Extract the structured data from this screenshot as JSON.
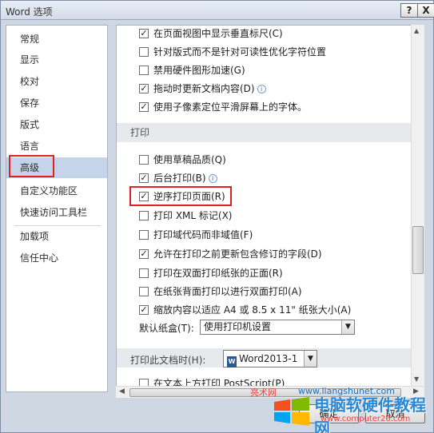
{
  "window": {
    "title": "Word 选项",
    "help": "?",
    "close": "X"
  },
  "sidebar": {
    "items": [
      {
        "label": "常规"
      },
      {
        "label": "显示"
      },
      {
        "label": "校对"
      },
      {
        "label": "保存"
      },
      {
        "label": "版式"
      },
      {
        "label": "语言"
      },
      {
        "label": "高级",
        "selected": true
      },
      {
        "label": "自定义功能区"
      },
      {
        "label": "快速访问工具栏"
      },
      {
        "label": "加载项"
      },
      {
        "label": "信任中心"
      }
    ]
  },
  "display_options": [
    {
      "label": "在页面视图中显示垂直标尺(C)",
      "checked": true
    },
    {
      "label": "针对版式而不是针对可读性优化字符位置",
      "checked": false
    },
    {
      "label": "禁用硬件图形加速(G)",
      "checked": false
    },
    {
      "label": "拖动时更新文档内容(D)",
      "checked": true,
      "info": true
    },
    {
      "label": "使用子像素定位平滑屏幕上的字体。",
      "checked": true
    }
  ],
  "print_section": {
    "title": "打印"
  },
  "print_options": [
    {
      "label": "使用草稿品质(Q)",
      "checked": false
    },
    {
      "label": "后台打印(B)",
      "checked": true,
      "info": true
    },
    {
      "label": "逆序打印页面(R)",
      "checked": true
    },
    {
      "label": "打印 XML 标记(X)",
      "checked": false
    },
    {
      "label": "打印域代码而非域值(F)",
      "checked": false
    },
    {
      "label": "允许在打印之前更新包含修订的字段(D)",
      "checked": true
    },
    {
      "label": "打印在双面打印纸张的正面(R)",
      "checked": false
    },
    {
      "label": "在纸张背面打印以进行双面打印(A)",
      "checked": false
    },
    {
      "label": "缩放内容以适应 A4 或 8.5 x 11\" 纸张大小(A)",
      "checked": true
    }
  ],
  "paper_tray": {
    "label": "默认纸盒(T):",
    "value": "使用打印机设置"
  },
  "doc_print": {
    "label": "打印此文档时(H):",
    "value": "Word2013-1",
    "icon_letter": "W"
  },
  "cutoff_option": {
    "label": "在文本上方打印 PostScript(P)"
  },
  "buttons": {
    "ok": "确定",
    "cancel": "取消"
  },
  "watermark": {
    "site1": "亮术网",
    "url": "www.liangshunet.com",
    "name": "电脑软硬件教程网",
    "url2": "www.computer26.com"
  },
  "colors": {
    "highlight_box": "#dd2222",
    "selected_nav": "#c5d4ea"
  }
}
